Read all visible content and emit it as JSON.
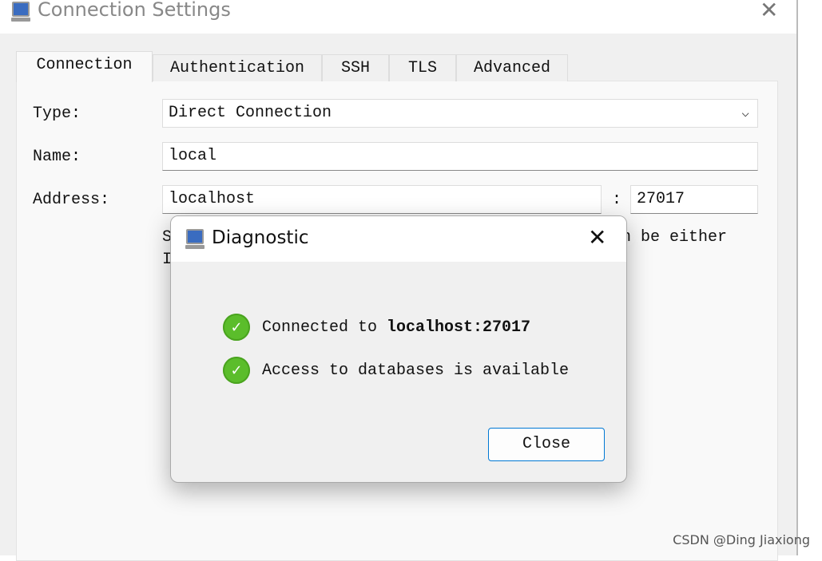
{
  "window": {
    "title": "Connection Settings",
    "close_icon": "close-icon"
  },
  "tabs": [
    {
      "label": "Connection",
      "active": true
    },
    {
      "label": "Authentication"
    },
    {
      "label": "SSH"
    },
    {
      "label": "TLS"
    },
    {
      "label": "Advanced"
    }
  ],
  "form": {
    "type_label": "Type:",
    "type_value": "Direct Connection",
    "name_label": "Name:",
    "name_value": "local",
    "address_label": "Address:",
    "host_value": "localhost",
    "port_sep": ":",
    "port_value": "27017",
    "hint_start": "S",
    "hint_end": "n be either",
    "hint_line2": "I"
  },
  "dialog": {
    "title": "Diagnostic",
    "messages": [
      {
        "prefix": "Connected to ",
        "bold": "localhost:27017"
      },
      {
        "prefix": "Access to databases is available",
        "bold": ""
      }
    ],
    "close_label": "Close",
    "status_color": "#5bbd2b"
  },
  "watermark": "CSDN @Ding Jiaxiong"
}
